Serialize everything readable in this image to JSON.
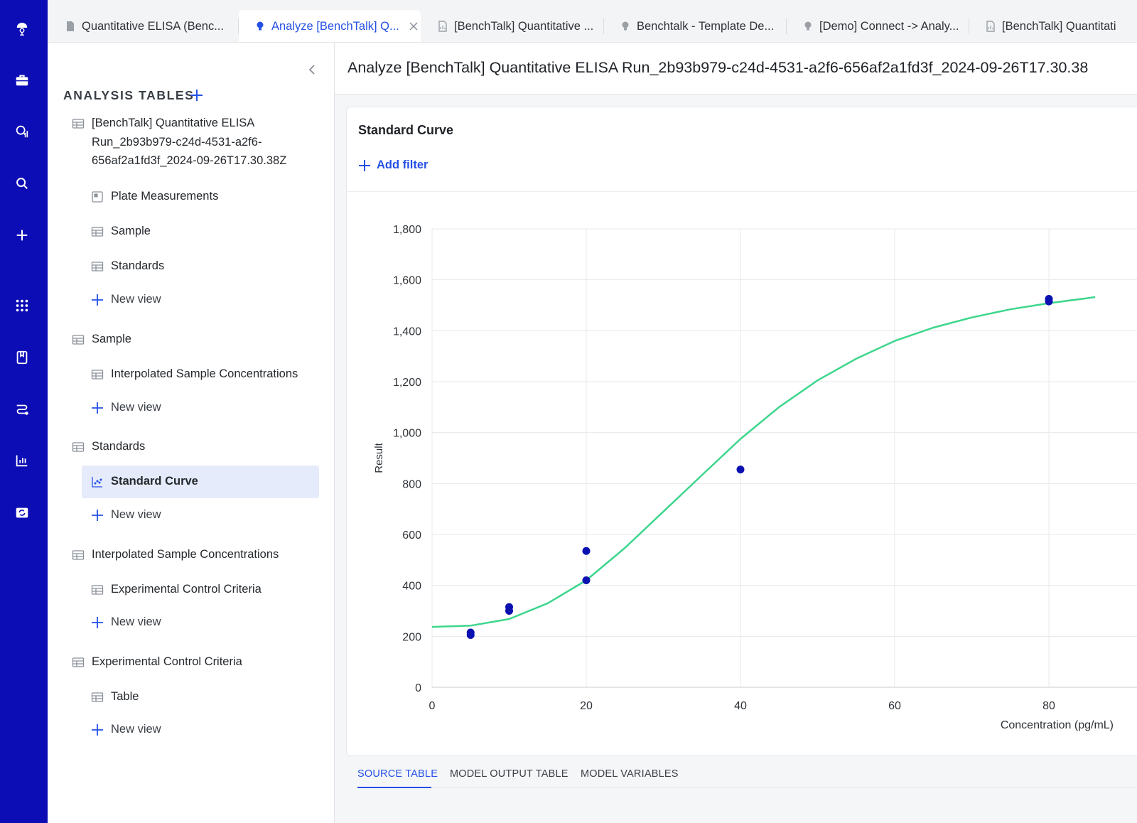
{
  "rail": {
    "items": [
      {
        "icon": "logo-icon"
      },
      {
        "icon": "briefcase-icon"
      },
      {
        "icon": "search-chart-icon"
      },
      {
        "icon": "search-icon"
      },
      {
        "icon": "plus-icon"
      },
      {
        "icon": "apps-grid-icon"
      },
      {
        "icon": "notebook-icon"
      },
      {
        "icon": "workflow-icon"
      },
      {
        "icon": "bar-chart-icon"
      },
      {
        "icon": "sync-folder-icon"
      }
    ]
  },
  "tabs": [
    {
      "label": "Quantitative ELISA (Benc...",
      "icon": "document-icon",
      "active": false
    },
    {
      "label": "Analyze [BenchTalk] Q...",
      "icon": "lightbulb-icon",
      "active": true
    },
    {
      "label": "[BenchTalk] Quantitative ...",
      "icon": "document-icon",
      "active": false
    },
    {
      "label": "Benchtalk - Template De...",
      "icon": "lightbulb-icon",
      "active": false
    },
    {
      "label": "[Demo] Connect -> Analy...",
      "icon": "lightbulb-icon",
      "active": false
    },
    {
      "label": "[BenchTalk] Quantitati",
      "icon": "document-icon",
      "active": false
    }
  ],
  "sidebar": {
    "section_title": "ANALYSIS TABLES",
    "items": [
      {
        "label": "[BenchTalk] Quantitative ELISA\nRun_2b93b979-c24d-4531-a2f6-\n656af2a1fd3f_2024-09-26T17.30.38Z"
      },
      {
        "label": "Plate Measurements"
      },
      {
        "label": "Sample"
      },
      {
        "label": "Standards"
      },
      {
        "label": "New view"
      },
      {
        "label": "Sample"
      },
      {
        "label": "Interpolated Sample Concentrations"
      },
      {
        "label": "New view"
      },
      {
        "label": "Standards"
      },
      {
        "label": "Standard Curve"
      },
      {
        "label": "New view"
      },
      {
        "label": "Interpolated Sample Concentrations"
      },
      {
        "label": "Experimental Control Criteria"
      },
      {
        "label": "New view"
      },
      {
        "label": "Experimental Control Criteria"
      },
      {
        "label": "Table"
      },
      {
        "label": "New view"
      }
    ]
  },
  "main": {
    "title": "Analyze [BenchTalk] Quantitative ELISA Run_2b93b979-c24d-4531-a2f6-656af2a1fd3f_2024-09-26T17.30.38",
    "card_title": "Standard Curve",
    "add_filter": "Add filter",
    "bottom_tabs": [
      "SOURCE TABLE",
      "MODEL OUTPUT TABLE",
      "MODEL VARIABLES"
    ]
  },
  "chart_data": {
    "type": "scatter",
    "title": "",
    "xlabel": "Concentration (pg/mL)",
    "ylabel": "Result",
    "xlim": [
      0,
      86
    ],
    "ylim": [
      0,
      1800
    ],
    "x_ticks": [
      0,
      20,
      40,
      60,
      80
    ],
    "y_ticks": [
      0,
      200,
      400,
      600,
      800,
      1000,
      1200,
      1400,
      1600,
      1800
    ],
    "y_tick_labels": [
      "0",
      "200",
      "400",
      "600",
      "800",
      "1,000",
      "1,200",
      "1,400",
      "1,600",
      "1,800"
    ],
    "grid": true,
    "point_color": "#0b10b0",
    "curve_color": "#3dd68c",
    "points": [
      {
        "x": 5,
        "y": 215
      },
      {
        "x": 5,
        "y": 205
      },
      {
        "x": 10,
        "y": 315
      },
      {
        "x": 10,
        "y": 300
      },
      {
        "x": 20,
        "y": 535
      },
      {
        "x": 20,
        "y": 420
      },
      {
        "x": 40,
        "y": 855
      },
      {
        "x": 80,
        "y": 1525
      },
      {
        "x": 80,
        "y": 1515
      }
    ],
    "curve": {
      "x": [
        0,
        5,
        10,
        15,
        20,
        25,
        30,
        35,
        40,
        45,
        50,
        55,
        60,
        65,
        70,
        75,
        80,
        85,
        86
      ],
      "y": [
        237,
        242,
        268,
        330,
        420,
        547,
        690,
        833,
        975,
        1100,
        1205,
        1290,
        1360,
        1412,
        1452,
        1484,
        1508,
        1528,
        1532
      ]
    }
  }
}
